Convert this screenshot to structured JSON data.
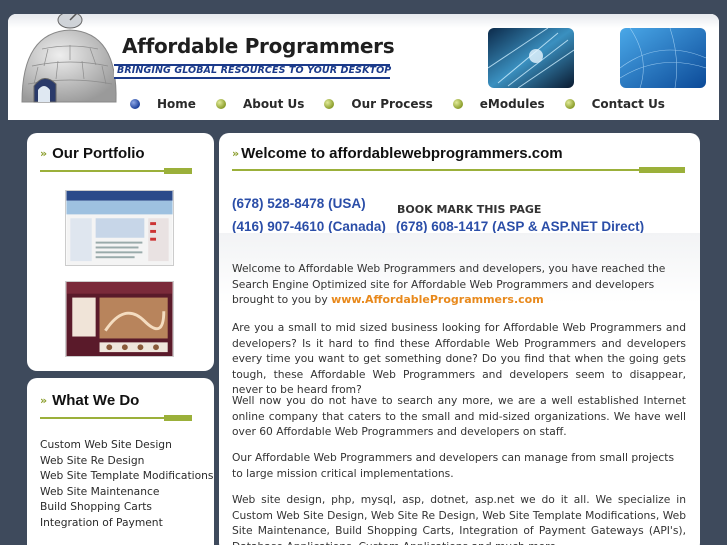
{
  "brand": {
    "title": "Affordable Programmers",
    "tagline": "BRINGING GLOBAL RESOURCES TO YOUR DESKTOP"
  },
  "nav": {
    "items": [
      {
        "label": "Home"
      },
      {
        "label": "About Us"
      },
      {
        "label": "Our Process"
      },
      {
        "label": "eModules"
      },
      {
        "label": "Contact Us"
      }
    ]
  },
  "portfolio": {
    "title": "Our Portfolio"
  },
  "what_we_do": {
    "title": "What We Do",
    "items": [
      "Custom Web Site Design",
      "Web Site Re Design",
      "Web Site Template Modifications",
      "Web Site Maintenance",
      "Build Shopping Carts",
      "Integration of Payment"
    ]
  },
  "main": {
    "title": "Welcome to affordablewebprogrammers.com",
    "phones": {
      "usa": "(678) 528-8478 (USA)",
      "canada": "(416) 907-4610 (Canada)",
      "direct": "(678) 608-1417 (ASP & ASP.NET Direct)"
    },
    "bookmark": "BOOK MARK THIS PAGE",
    "para1": "Welcome to Affordable Web Programmers and developers, you have reached the Search Engine Optimized site for Affordable Web Programmers and developers brought to you by",
    "para1_link": "www.AffordableProgrammers.com",
    "para2": "Are you a small to mid sized business looking for Affordable Web Programmers and developers? Is it hard to find these Affordable Web Programmers and developers every time you want to get something done? Do you find that when the going gets tough, these Affordable Web Programmers and developers seem to disappear, never to be heard from?",
    "para3": "Well now you do not have to search any more, we are a well established Internet online company that caters to the small and mid-sized organizations. We have well over 60 Affordable Web Programmers and developers on staff.",
    "para4": "Our Affordable Web Programmers and developers can manage from small projects to large mission critical implementations.",
    "para5": "Web site design, php, mysql, asp, dotnet, asp.net we do it all. We specialize in Custom Web Site Design, Web Site Re Design, Web Site Template Modifications, Web Site Maintenance, Build Shopping Carts, Integration of Payment Gateways (API's), Database Applications, Custom Applications and much more."
  },
  "colors": {
    "background": "#3e4a5c",
    "accent_green": "#9bb03a",
    "phone_blue": "#2b4ea8",
    "link_orange": "#e8891c",
    "tagline_blue": "#1b3a8a"
  }
}
